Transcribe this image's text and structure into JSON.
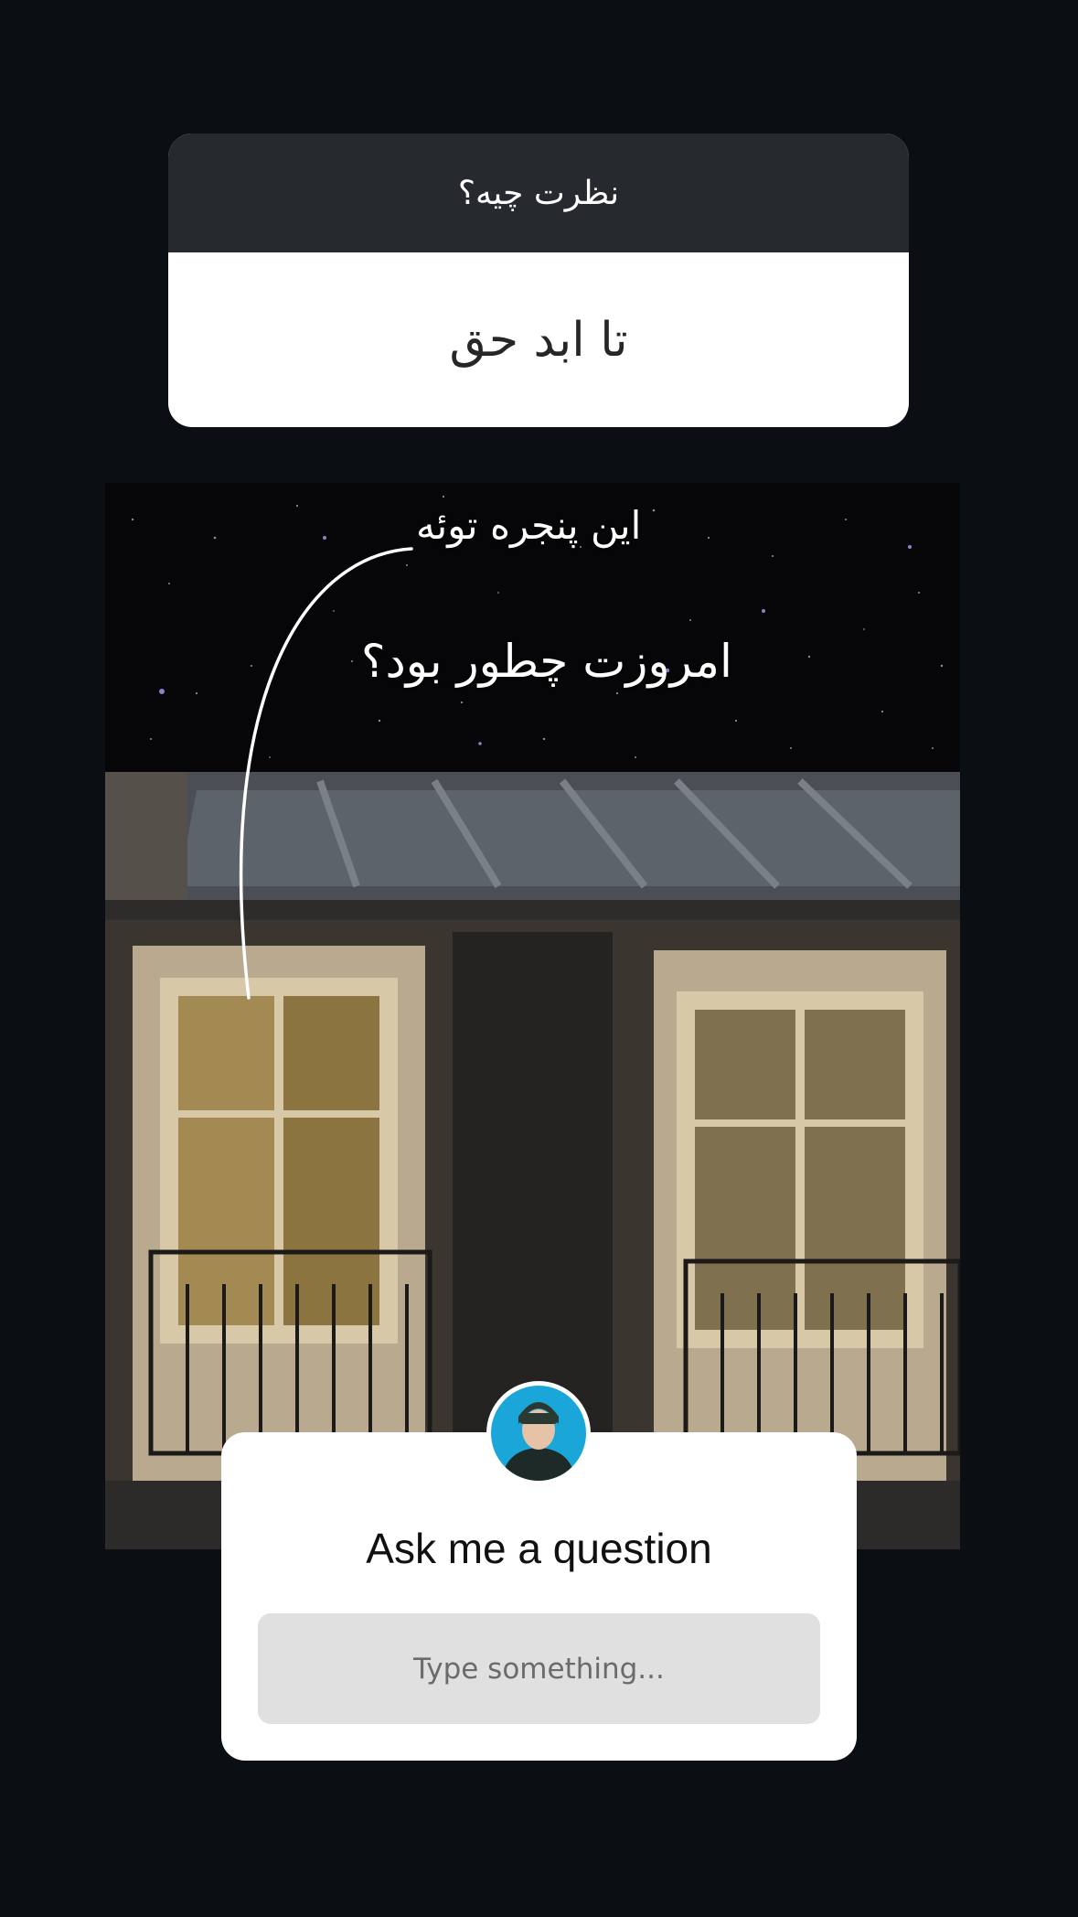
{
  "response_card": {
    "question": "نظرت چیه؟",
    "answer": "تا ابد حق"
  },
  "story": {
    "caption_window": "این پنجره توئه",
    "caption_today": "امروزت چطور بود؟"
  },
  "question_sticker": {
    "avatar_icon": "profile-photo",
    "title": "Ask me a question",
    "input_placeholder": "Type something..."
  },
  "colors": {
    "background": "#0b0f14",
    "header_dark": "#262a2f",
    "input_gray": "#e0e0e0",
    "avatar_ring": "#1aa6d8"
  }
}
